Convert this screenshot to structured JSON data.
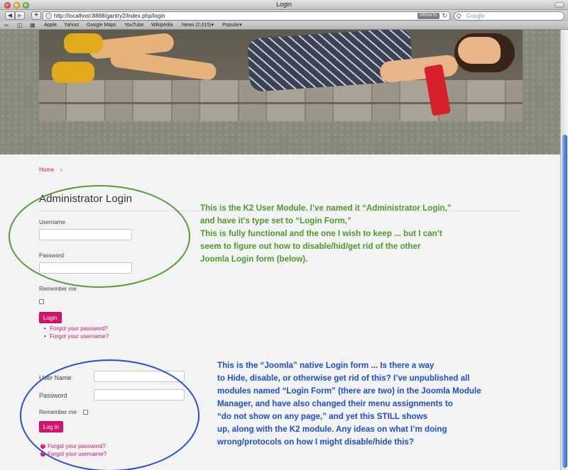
{
  "window": {
    "title": "Login"
  },
  "toolbar": {
    "back": "◀",
    "forward": "▶",
    "add": "+",
    "url": "http://localhost:8888/gantry2/index.php/login",
    "private_badge": "PRIVATE",
    "reload": "↻",
    "search_placeholder": "Google",
    "search_icon": "Q"
  },
  "bookmarks": {
    "items": [
      "Apple",
      "Yahoo!",
      "Google Maps",
      "YouTube",
      "Wikipedia",
      "News (2,015)▾",
      "Popular▾"
    ]
  },
  "breadcrumb": {
    "home": "Home",
    "separator": "›"
  },
  "k2_login": {
    "title": "Administrator Login",
    "username_label": "Username",
    "password_label": "Password",
    "remember_label": "Remember me",
    "submit": "Login",
    "links": [
      "Forgot your password?",
      "Forgot your username?"
    ]
  },
  "native_login": {
    "username_label": "User Name",
    "password_label": "Password",
    "remember_label": "Remember me",
    "submit": "Log in",
    "links": [
      "Forgot your password?",
      "Forgot your username?"
    ],
    "link_icon": "?"
  },
  "annotations": {
    "green": [
      "This is the K2 User Module. I’ve named it “Administrator Login,”",
      "and have it’s type set to “Login Form,”",
      "This is fully functional and the one I wish to keep ... but I can’t",
      "seem to figure out how to disable/hid/get rid of the other",
      "Joomla Login form (below)."
    ],
    "blue": [
      "This is the “Joomla” native Login form ... Is there a way",
      "to Hide, disable, or otherwise get rid of this? I’ve unpublished all",
      "modules named “Login Form” (there are two) in the Joomla Module",
      "Manager, and have also changed their menu assignments to",
      "“do not show on any page,” and yet this STILL shows",
      "up, along with the K2 module. Any ideas on what I’m doing",
      "wrong/protocols on how I might disable/hide this?"
    ]
  },
  "colors": {
    "accent": "#d6156e",
    "annotation_green": "#4e9a2b",
    "annotation_blue": "#1a4fd6"
  }
}
